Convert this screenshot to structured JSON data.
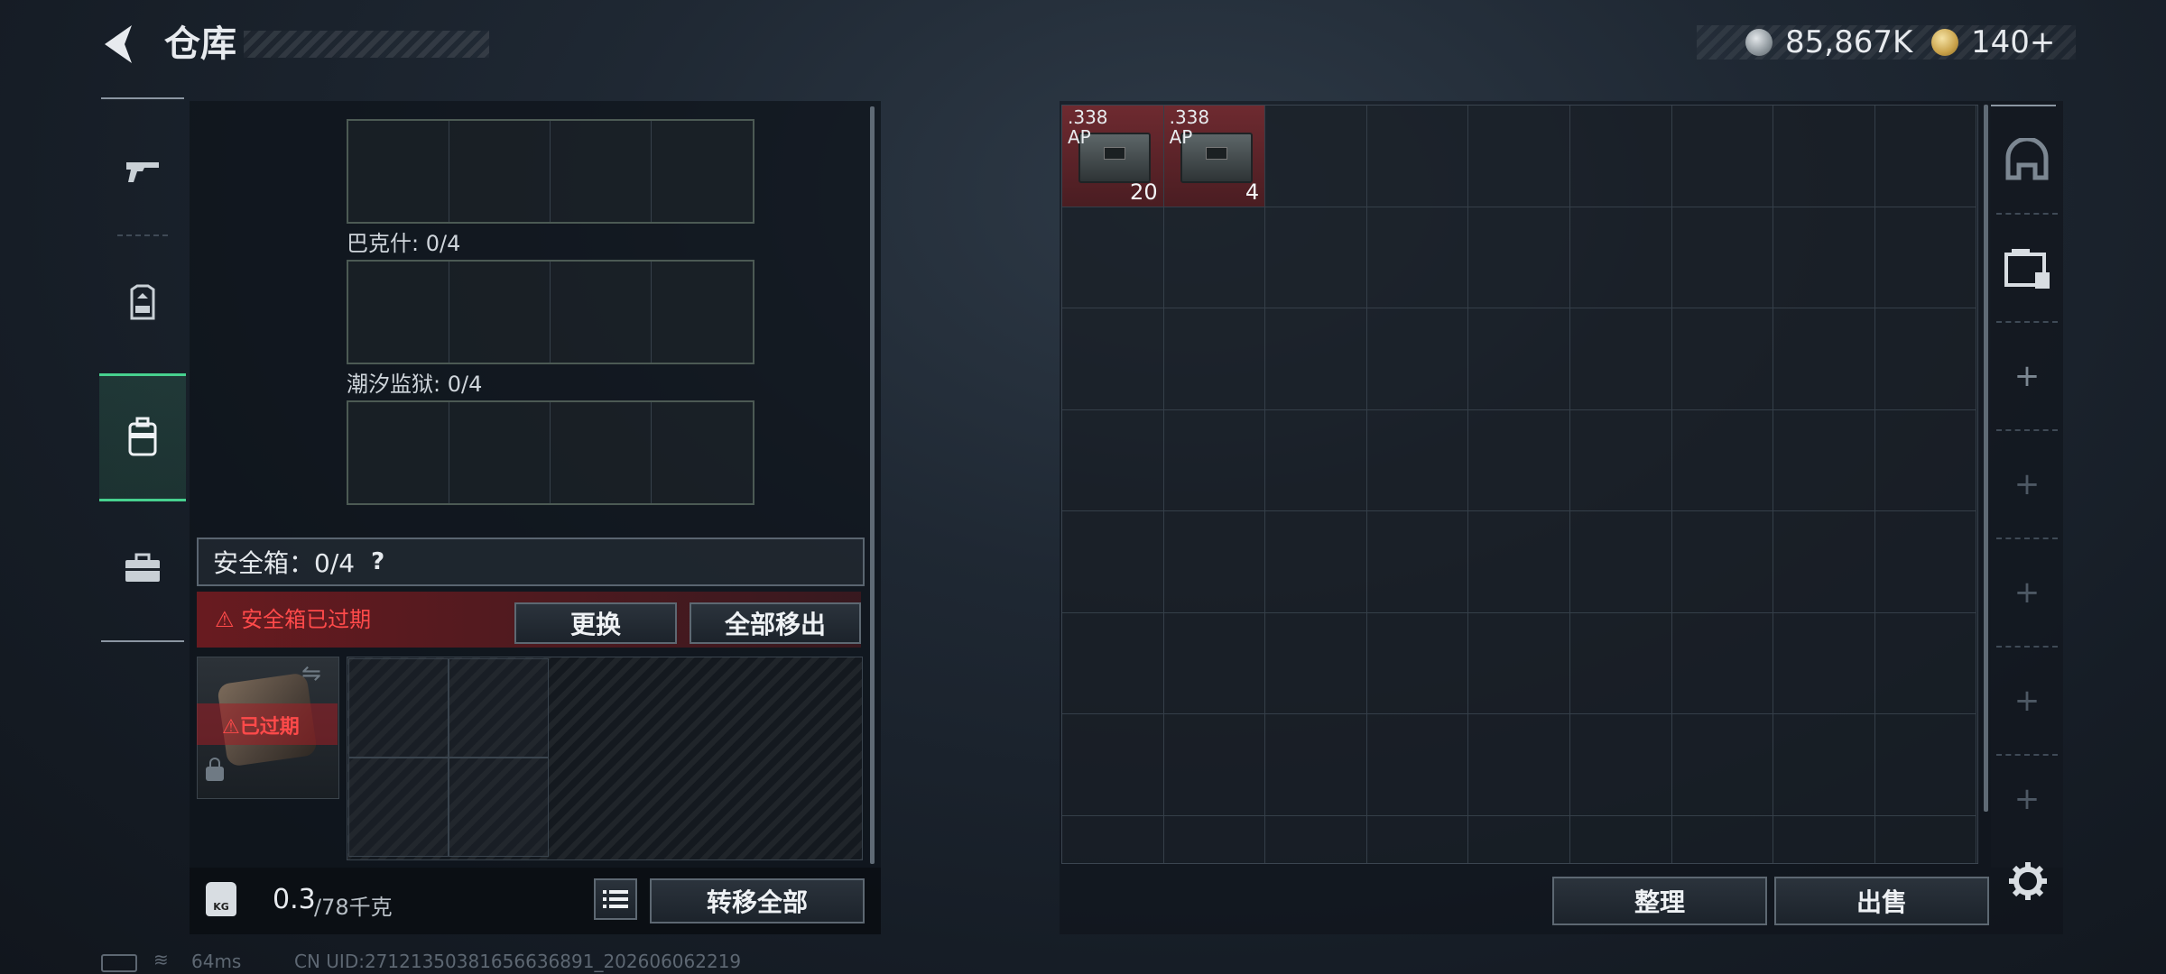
{
  "header": {
    "title": "仓库"
  },
  "currency": {
    "coin1": "85,867K",
    "coin2": "140+"
  },
  "nav": {
    "items": [
      "firearms",
      "armor",
      "backpack",
      "tools"
    ],
    "active_index": 2
  },
  "left": {
    "map_slots": [
      {
        "label": "巴克什: 0/4"
      },
      {
        "label": "潮汐监狱: 0/4"
      }
    ],
    "safebox": {
      "label": "安全箱：0/4",
      "help": "?"
    },
    "expired_warning": "⚠ 安全箱已过期",
    "replace_label": "更换",
    "move_all_label": "全部移出",
    "case_expired_label": "⚠已过期",
    "weight": {
      "current": "0.3",
      "max": "/78千克",
      "icon_text": "KG"
    },
    "transfer_all_label": "转移全部"
  },
  "footer": {
    "ping": "64ms",
    "uid": "CN UID:27121350381656636891_202606062219"
  },
  "stash": {
    "items": [
      {
        "caliber": ".338\nAP",
        "count": "20"
      },
      {
        "caliber": ".338\nAP",
        "count": "4"
      }
    ],
    "sort_label": "整理",
    "sell_label": "出售"
  },
  "right_tabs": [
    "home-icon",
    "stash-tier-icon",
    "add-icon",
    "add-icon",
    "add-icon",
    "add-icon",
    "add-icon"
  ]
}
